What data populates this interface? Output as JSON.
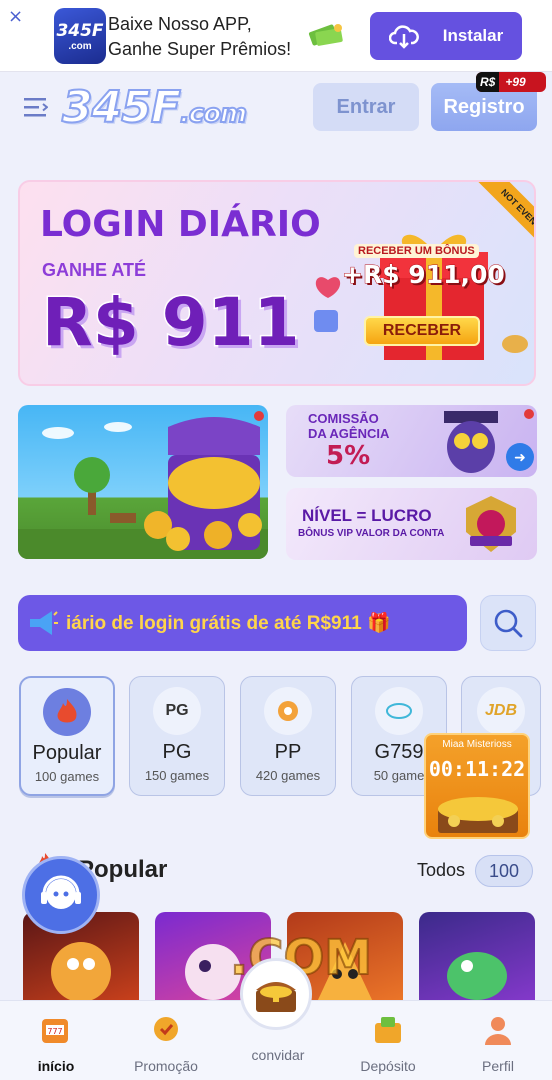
{
  "app_banner": {
    "close_glyph": "×",
    "app_logo_text": "345F",
    "app_logo_sub": ".com",
    "line1": "Baixe Nosso APP,",
    "line2": "Ganhe Super Prêmios!",
    "install_label": "Instalar",
    "install_icon": "cloud-download-icon"
  },
  "header": {
    "logo_main": "345F",
    "logo_suffix": ".com",
    "login_label": "Entrar",
    "register_label": "Registro",
    "register_badge_currency": "R$",
    "register_badge_value": "+99"
  },
  "login_banner": {
    "title": "LOGIN DIÁRIO",
    "subtitle": "GANHE ATÉ",
    "amount": "R$ 911",
    "bonus_caption": "RECEBER UM BÔNUS",
    "bonus_value": "+R$ 911,00",
    "claim_label": "RECEBER",
    "ribbon": "NOT EVENTS"
  },
  "promo_cards": {
    "agency_line1": "COMISSÃO",
    "agency_line2": "DA AGÊNCIA",
    "agency_percent": "5%",
    "vip_title": "NÍVEL = LUCRO",
    "vip_subtitle": "BÔNUS VIP VALOR DA CONTA"
  },
  "marquee": {
    "text": "iário de login grátis de até R$911 🎁"
  },
  "categories": [
    {
      "name": "Popular",
      "count": "100 games",
      "icon": "flame-icon"
    },
    {
      "name": "PG",
      "count": "150 games",
      "icon_text": "PG"
    },
    {
      "name": "PP",
      "count": "420 games",
      "icon": "pp-icon"
    },
    {
      "name": "G759",
      "count": "50 game",
      "icon": "g759-icon"
    },
    {
      "name": "JDB",
      "count": "",
      "icon_text": "JDB"
    }
  ],
  "mystery": {
    "label": "Miaa Misterioss",
    "timer": "00:11:22"
  },
  "popular": {
    "title": "Popular",
    "all_label": "Todos",
    "all_count": "100"
  },
  "watermark": ".COM",
  "bottom_nav": [
    {
      "label": "início",
      "icon": "slot-machine-icon",
      "active": true
    },
    {
      "label": "Promoção",
      "icon": "medal-icon",
      "active": false
    },
    {
      "label": "convidar",
      "icon": "treasure-chest-icon",
      "active": false
    },
    {
      "label": "Depósito",
      "icon": "wallet-icon",
      "active": false
    },
    {
      "label": "Perfil",
      "icon": "user-icon",
      "active": false
    }
  ],
  "colors": {
    "primary": "#6d58e6",
    "marquee_text": "#ffd54a",
    "accent_red": "#c8141f"
  }
}
